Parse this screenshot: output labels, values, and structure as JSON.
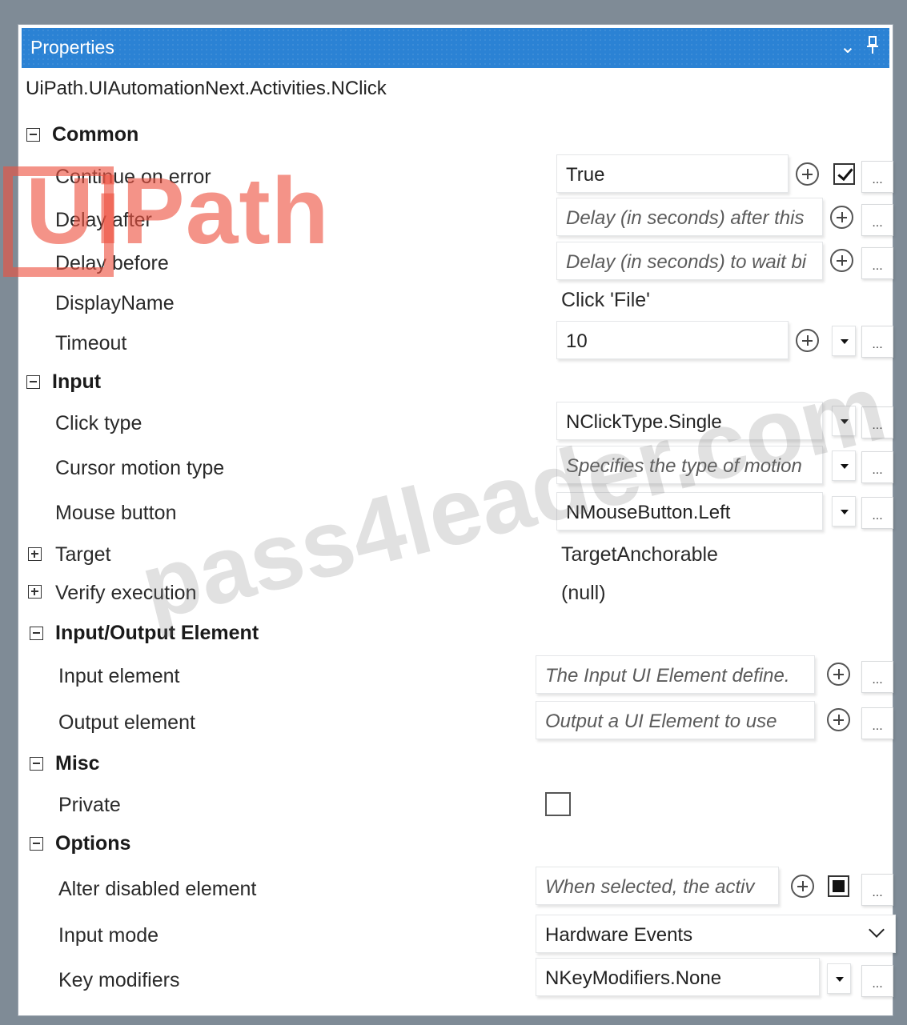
{
  "panel": {
    "title": "Properties",
    "class_name": "UiPath.UIAutomationNext.Activities.NClick",
    "collapse_glyph": "⌄",
    "pin_icon": "pin-icon"
  },
  "watermarks": {
    "logo": "UiPath",
    "site": "pass4leader.com"
  },
  "categories": {
    "common": "Common",
    "input": "Input",
    "io_element": "Input/Output Element",
    "misc": "Misc",
    "options": "Options"
  },
  "properties": {
    "continue_on_error": {
      "label": "Continue on error",
      "value": "True",
      "checked": true
    },
    "delay_after": {
      "label": "Delay after",
      "placeholder": "Delay (in seconds) after this"
    },
    "delay_before": {
      "label": "Delay before",
      "placeholder": "Delay (in seconds) to wait bi"
    },
    "display_name": {
      "label": "DisplayName",
      "value": "Click 'File'"
    },
    "timeout": {
      "label": "Timeout",
      "value": "10"
    },
    "click_type": {
      "label": "Click type",
      "value": "NClickType.Single"
    },
    "cursor_motion_type": {
      "label": "Cursor motion type",
      "placeholder": "Specifies the type of motion"
    },
    "mouse_button": {
      "label": "Mouse button",
      "value": "NMouseButton.Left"
    },
    "target": {
      "label": "Target",
      "value": "TargetAnchorable"
    },
    "verify_execution": {
      "label": "Verify execution",
      "value": "(null)"
    },
    "input_element": {
      "label": "Input element",
      "placeholder": "The Input UI Element define."
    },
    "output_element": {
      "label": "Output element",
      "placeholder": "Output a UI Element to use"
    },
    "private": {
      "label": "Private",
      "checked": false
    },
    "alter_disabled_element": {
      "label": "Alter disabled element",
      "placeholder": "When selected, the activ"
    },
    "input_mode": {
      "label": "Input mode",
      "value": "Hardware Events"
    },
    "key_modifiers": {
      "label": "Key modifiers",
      "value": "NKeyModifiers.None"
    }
  },
  "buttons": {
    "more": "..."
  },
  "colors": {
    "title_bar": "#2b82d4",
    "logo_watermark": "#ee503f"
  }
}
